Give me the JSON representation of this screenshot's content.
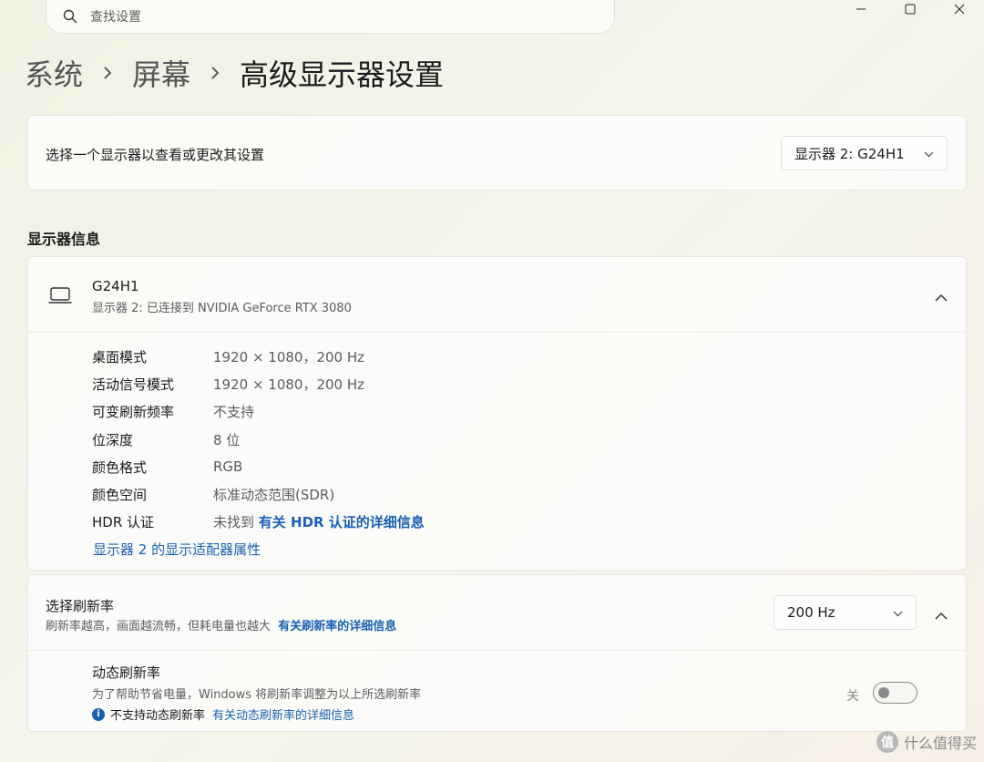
{
  "search": {
    "placeholder": "查找设置"
  },
  "breadcrumb": {
    "level1": "系统",
    "level2": "屏幕",
    "current": "高级显示器设置"
  },
  "display_select": {
    "label": "选择一个显示器以查看或更改其设置",
    "value": "显示器 2: G24H1"
  },
  "display_info": {
    "section_title": "显示器信息",
    "name": "G24H1",
    "subtitle": "显示器 2: 已连接到 NVIDIA GeForce RTX 3080",
    "rows": [
      {
        "key": "桌面模式",
        "value": "1920 × 1080，200 Hz"
      },
      {
        "key": "活动信号模式",
        "value": "1920 × 1080，200 Hz"
      },
      {
        "key": "可变刷新频率",
        "value": "不支持"
      },
      {
        "key": "位深度",
        "value": "8 位"
      },
      {
        "key": "颜色格式",
        "value": "RGB"
      },
      {
        "key": "颜色空间",
        "value": "标准动态范围(SDR)"
      },
      {
        "key": "HDR 认证",
        "value": "未找到",
        "link": "有关 HDR 认证的详细信息"
      }
    ],
    "adapter_link": "显示器 2 的显示适配器属性"
  },
  "refresh": {
    "title": "选择刷新率",
    "desc": "刷新率越高，画面越流畅，但耗电量也越大",
    "desc_link": "有关刷新率的详细信息",
    "value": "200 Hz",
    "dynamic": {
      "title": "动态刷新率",
      "desc": "为了帮助节省电量，Windows 将刷新率调整为以上所选刷新率",
      "notice": "不支持动态刷新率",
      "notice_link": "有关动态刷新率的详细信息",
      "toggle_label": "关",
      "toggle_on": false
    }
  },
  "watermark": {
    "logo": "值",
    "text": "什么值得买"
  }
}
